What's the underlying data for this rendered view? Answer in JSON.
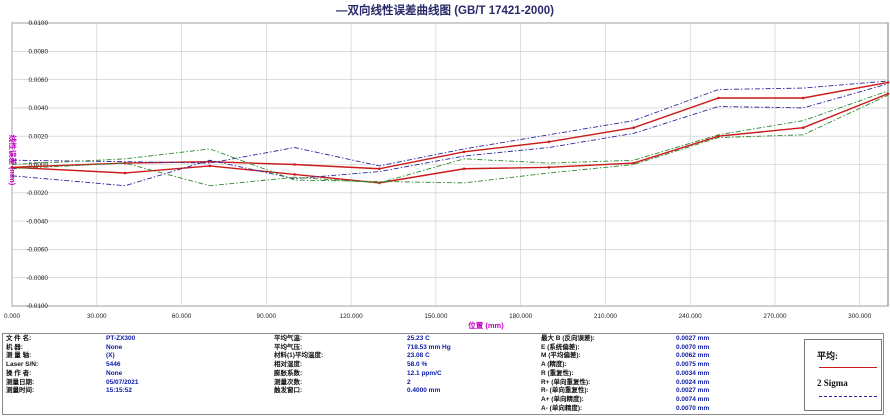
{
  "chart_data": {
    "type": "line",
    "title": "—双向线性误差曲线图  (GB/T 17421-2000)",
    "xlabel": "位置 (mm)",
    "ylabel": "线性误差 (mm)",
    "xlim": [
      0,
      310
    ],
    "ylim": [
      -0.01,
      0.01
    ],
    "x_ticks": [
      "0.000",
      "30.000",
      "60.000",
      "90.000",
      "120.000",
      "150.000",
      "180.000",
      "210.000",
      "240.000",
      "270.000",
      "300.000"
    ],
    "y_ticks": [
      "0.0100",
      "0.0080",
      "0.0060",
      "0.0040",
      "0.0020",
      "0.0000",
      "-0.0020",
      "-0.0040",
      "-0.0060",
      "-0.0080",
      "-0.0100"
    ],
    "grid": true,
    "x": [
      0,
      40,
      70,
      100,
      130,
      160,
      190,
      220,
      250,
      280,
      310
    ],
    "series": [
      {
        "name": "平均",
        "style": "solid",
        "color": "#cc1a1a",
        "values": [
          -0.0002,
          0.0001,
          0.0002,
          0.0,
          -0.0003,
          0.0009,
          0.0016,
          0.0026,
          0.0047,
          0.0047,
          0.0058
        ]
      },
      {
        "name": "平均",
        "style": "solid",
        "color": "#cc1a1a",
        "values": [
          -0.0002,
          -0.0006,
          -0.0001,
          -0.0007,
          -0.0013,
          -0.0003,
          -0.0002,
          0.0001,
          0.002,
          0.0026,
          0.005
        ]
      },
      {
        "name": "2 Sigma",
        "style": "dashdot",
        "color": "#2a2aa0",
        "values": [
          0.0003,
          0.0002,
          0.0001,
          0.0012,
          -0.0001,
          0.0011,
          0.0021,
          0.0031,
          0.0053,
          0.0054,
          0.0059
        ]
      },
      {
        "name": "2 Sigma",
        "style": "dashdot",
        "color": "#2a2aa0",
        "values": [
          -0.0008,
          -0.0015,
          0.0003,
          -0.001,
          -0.0005,
          0.0006,
          0.0012,
          0.0022,
          0.0041,
          0.004,
          0.0057
        ]
      },
      {
        "name": "2 Sigma",
        "style": "dashdot",
        "color": "#2f8a2f",
        "values": [
          0.0,
          0.0004,
          0.0011,
          -0.0011,
          -0.0012,
          -0.0013,
          -0.0006,
          0.0,
          0.0019,
          0.0021,
          0.0049
        ]
      },
      {
        "name": "2 Sigma",
        "style": "dashdot",
        "color": "#2f8a2f",
        "values": [
          -0.0003,
          0.0001,
          -0.0015,
          -0.0009,
          -0.0013,
          0.0004,
          0.0001,
          0.0003,
          0.0021,
          0.0031,
          0.0052
        ]
      }
    ]
  },
  "info": {
    "col1": [
      {
        "label": "文 件 名:",
        "value": "PT-ZX300"
      },
      {
        "label": "机    器:",
        "value": "None"
      },
      {
        "label": "测 量 轴:",
        "value": "(X)"
      },
      {
        "label": "Laser S/N:",
        "value": "5446"
      },
      {
        "label": "操 作 者:",
        "value": "None"
      },
      {
        "label": "测量日期:",
        "value": "05/07/2021"
      },
      {
        "label": "测量时间:",
        "value": "15:15:52"
      }
    ],
    "col2": [
      {
        "label": "平均气温:",
        "value": "25.23 C"
      },
      {
        "label": "平均气压:",
        "value": "718.53 mm Hg"
      },
      {
        "label": "材料(1)平均温度:",
        "value": "23.08 C"
      },
      {
        "label": "相对湿度:",
        "value": "58.0 %"
      },
      {
        "label": "膨胀系数:",
        "value": "12.1 ppm/C"
      },
      {
        "label": "测量次数:",
        "value": "2"
      },
      {
        "label": "触发窗口:",
        "value": "0.4000 mm"
      }
    ],
    "col3": [
      {
        "label": "最大 B (反向误差):",
        "value": "0.0027 mm"
      },
      {
        "label": "E (系统偏差):",
        "value": "0.0070 mm"
      },
      {
        "label": "M (平均偏差):",
        "value": "0.0062 mm"
      },
      {
        "label": "A (精度):",
        "value": "0.0075 mm"
      },
      {
        "label": "R (重复性):",
        "value": "0.0034 mm"
      },
      {
        "label": "R+ (单向重复性):",
        "value": "0.0024 mm"
      },
      {
        "label": "R- (单向重复性):",
        "value": "0.0027 mm"
      },
      {
        "label": "A+ (单向精度):",
        "value": "0.0074 mm"
      },
      {
        "label": "A- (单向精度):",
        "value": "0.0070 mm"
      }
    ]
  },
  "legend": {
    "mean_label": "平均:",
    "mean_color": "#cc1a1a",
    "sigma_label": "2 Sigma",
    "sigma_color": "#2a2aa0"
  }
}
